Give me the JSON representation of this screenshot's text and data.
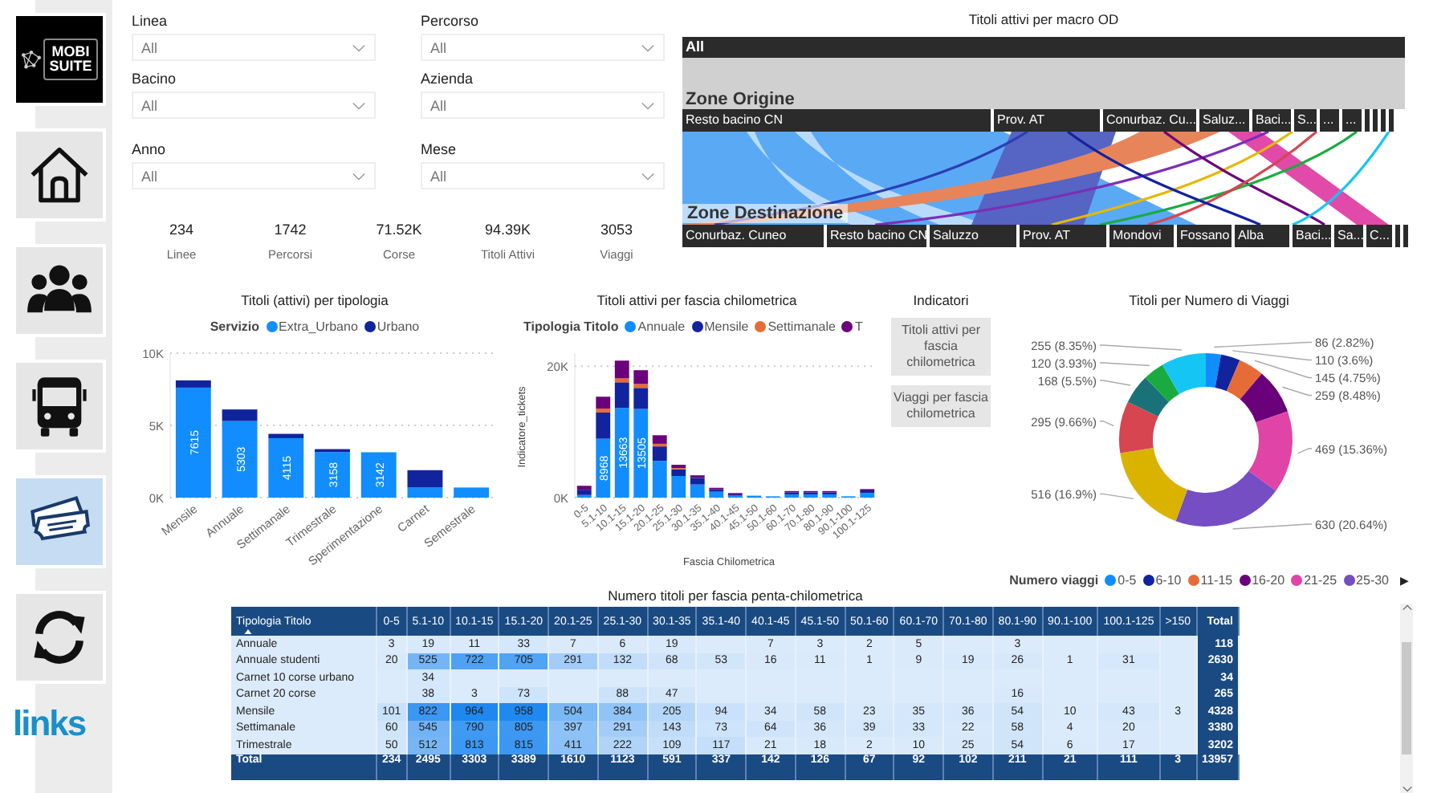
{
  "sidebar": {
    "logo_text": "MOBI SUITE",
    "nav": [
      {
        "kind": "home",
        "selected": false
      },
      {
        "kind": "people",
        "selected": false
      },
      {
        "kind": "bus",
        "selected": false
      },
      {
        "kind": "tickets",
        "selected": true
      },
      {
        "kind": "refresh",
        "selected": false
      }
    ],
    "footer_logo": "links"
  },
  "filters": [
    {
      "label": "Linea",
      "value": "All"
    },
    {
      "label": "Percorso",
      "value": "All"
    },
    {
      "label": "Bacino",
      "value": "All"
    },
    {
      "label": "Azienda",
      "value": "All"
    },
    {
      "label": "Anno",
      "value": "All"
    },
    {
      "label": "Mese",
      "value": "All"
    }
  ],
  "kpis": [
    {
      "value": "234",
      "label": "Linee"
    },
    {
      "value": "1742",
      "label": "Percorsi"
    },
    {
      "value": "71.52K",
      "label": "Corse"
    },
    {
      "value": "94.39K",
      "label": "Titoli Attivi"
    },
    {
      "value": "3053",
      "label": "Viaggi"
    }
  ],
  "od_chart": {
    "title": "Titoli attivi per macro OD",
    "root": "All",
    "origin_label": "Zone Origine",
    "destination_label": "Zone Destinazione",
    "origins": [
      "Resto bacino CN",
      "Prov. AT",
      "Conurbaz. Cu...",
      "Saluz...",
      "Baci...",
      "S...",
      "...",
      "..."
    ],
    "destinations": [
      "Conurbaz. Cuneo",
      "Resto bacino CN",
      "Saluzzo",
      "Prov. AT",
      "Mondovi",
      "Fossano",
      "Alba",
      "Baci...",
      "Sa...",
      "C..."
    ]
  },
  "type_chart": {
    "title": "Titoli (attivi) per tipologia",
    "legend_title": "Servizio",
    "chart_data": {
      "type": "bar",
      "stacked": true,
      "categories": [
        "Mensile",
        "Annuale",
        "Settimanale",
        "Trimestrale",
        "Sperimentazione",
        "Carnet",
        "Semestrale"
      ],
      "series": [
        {
          "name": "Extra_Urbano",
          "color": "#118dff",
          "values": [
            7615,
            5303,
            4115,
            3158,
            3142,
            700,
            700
          ],
          "value_labels": [
            "7615",
            "5303",
            "4115",
            "3158",
            "3142",
            null,
            null
          ]
        },
        {
          "name": "Urbano",
          "color": "#12239e",
          "values": [
            500,
            800,
            300,
            200,
            0,
            1200,
            0
          ],
          "value_labels": [
            null,
            null,
            null,
            null,
            null,
            null,
            null
          ]
        }
      ],
      "ylim": [
        0,
        10000
      ],
      "yticks": [
        {
          "value": 0,
          "label": "0K"
        },
        {
          "value": 5000,
          "label": "5K"
        },
        {
          "value": 10000,
          "label": "10K"
        }
      ]
    }
  },
  "km_chart": {
    "title": "Titoli attivi per fascia chilometrica",
    "legend_title": "Tipologia Titolo",
    "chart_data": {
      "type": "bar",
      "stacked": true,
      "xlabel": "Fascia Chilometrica",
      "ylabel": "Indicatore_tickets",
      "categories": [
        "0-5",
        "5.1-10",
        "10.1-15",
        "15.1-20",
        "20.1-25",
        "25.1-30",
        "30.1-35",
        "35.1-40",
        "40.1-45",
        "45.1-50",
        "50.1-60",
        "60.1-70",
        "70.1-80",
        "80.1-90",
        "90.1-100",
        "100.1-125"
      ],
      "series": [
        {
          "name": "Annuale",
          "color": "#118dff",
          "values": [
            400,
            8968,
            13663,
            13505,
            5600,
            3300,
            2000,
            900,
            300,
            300,
            200,
            500,
            500,
            500,
            200,
            700
          ],
          "value_labels": [
            null,
            "8968",
            "13663",
            "13505",
            null,
            null,
            null,
            null,
            null,
            null,
            null,
            null,
            null,
            null,
            null,
            null
          ]
        },
        {
          "name": "Mensile",
          "color": "#12239e",
          "values": [
            800,
            4000,
            3900,
            3200,
            2200,
            1000,
            1000,
            400,
            200,
            0,
            0,
            300,
            300,
            300,
            0,
            400
          ],
          "value_labels": [
            null,
            null,
            null,
            null,
            null,
            null,
            null,
            null,
            null,
            null,
            null,
            null,
            null,
            null,
            null,
            null
          ]
        },
        {
          "name": "Settimanale",
          "color": "#e66c37",
          "values": [
            0,
            600,
            600,
            600,
            400,
            200,
            0,
            0,
            0,
            0,
            0,
            0,
            0,
            0,
            0,
            0
          ],
          "value_labels": [
            null,
            null,
            null,
            null,
            null,
            null,
            null,
            null,
            null,
            null,
            null,
            null,
            null,
            null,
            null,
            null
          ]
        },
        {
          "name": "T",
          "color": "#6b007b",
          "values": [
            600,
            1800,
            2700,
            2100,
            1300,
            500,
            400,
            200,
            200,
            0,
            0,
            200,
            200,
            200,
            0,
            200
          ],
          "value_labels": [
            null,
            null,
            null,
            null,
            null,
            null,
            null,
            null,
            null,
            null,
            null,
            null,
            null,
            null,
            null,
            null
          ]
        }
      ],
      "ylim": [
        0,
        22000
      ],
      "yticks": [
        {
          "value": 0,
          "label": "0K"
        },
        {
          "value": 20000,
          "label": "20K"
        }
      ]
    }
  },
  "indicators": {
    "title": "Indicatori",
    "buttons": [
      "Titoli attivi per fascia chilometrica",
      "Viaggi per fascia chilometrica"
    ]
  },
  "trips_chart": {
    "title": "Titoli per Numero di Viaggi",
    "legend_title": "Numero viaggi",
    "legend_next": "▶",
    "chart_data": {
      "type": "donut",
      "categories": [
        "0-5",
        "6-10",
        "11-15",
        "16-20",
        "21-25",
        "25-30",
        null,
        null,
        null,
        null,
        null
      ],
      "series": [
        {
          "values": [
            86,
            110,
            145,
            259,
            469,
            630,
            516,
            295,
            168,
            120,
            255
          ],
          "colors": [
            "#118dff",
            "#12239e",
            "#e66c37",
            "#6b007b",
            "#e044a7",
            "#744ec2",
            "#d9b300",
            "#d64550",
            "#197278",
            "#1aab40",
            "#15c6f4"
          ],
          "value_labels": [
            "86 (2.82%)",
            "110 (3.6%)",
            "145 (4.75%)",
            "259 (8.48%)",
            "469 (15.36%)",
            "630 (20.64%)",
            "516 (16.9%)",
            "295 (9.66%)",
            "168 (5.5%)",
            "120 (3.93%)",
            "255 (8.35%)"
          ]
        }
      ]
    }
  },
  "table": {
    "title": "Numero titoli per fascia penta-chilometrica",
    "columns": [
      "Tipologia Titolo",
      "0-5",
      "5.1-10",
      "10.1-15",
      "15.1-20",
      "20.1-25",
      "25.1-30",
      "30.1-35",
      "35.1-40",
      "40.1-45",
      "45.1-50",
      "50.1-60",
      "60.1-70",
      "70.1-80",
      "80.1-90",
      "90.1-100",
      "100.1-125",
      ">150",
      "Total"
    ],
    "rows": [
      {
        "cells": [
          "Annuale",
          "3",
          "19",
          "11",
          "33",
          "7",
          "6",
          "19",
          "",
          "7",
          "3",
          "2",
          "5",
          "",
          "3",
          "",
          "",
          "",
          "118"
        ]
      },
      {
        "cells": [
          "Annuale studenti",
          "20",
          "525",
          "722",
          "705",
          "291",
          "132",
          "68",
          "53",
          "16",
          "11",
          "1",
          "9",
          "19",
          "26",
          "1",
          "31",
          "",
          "2630"
        ]
      },
      {
        "cells": [
          "Carnet 10 corse urbano",
          "",
          "34",
          "",
          "",
          "",
          "",
          "",
          "",
          "",
          "",
          "",
          "",
          "",
          "",
          "",
          "",
          "",
          "34"
        ]
      },
      {
        "cells": [
          "Carnet 20 corse",
          "",
          "38",
          "3",
          "73",
          "",
          "88",
          "47",
          "",
          "",
          "",
          "",
          "",
          "",
          "16",
          "",
          "",
          "",
          "265"
        ]
      },
      {
        "cells": [
          "Mensile",
          "101",
          "822",
          "964",
          "958",
          "504",
          "384",
          "205",
          "94",
          "34",
          "58",
          "23",
          "35",
          "36",
          "54",
          "10",
          "43",
          "3",
          "4328"
        ]
      },
      {
        "cells": [
          "Settimanale",
          "60",
          "545",
          "790",
          "805",
          "397",
          "291",
          "143",
          "73",
          "64",
          "36",
          "39",
          "33",
          "22",
          "58",
          "4",
          "20",
          "",
          "3380"
        ]
      },
      {
        "cells": [
          "Trimestrale",
          "50",
          "512",
          "813",
          "815",
          "411",
          "222",
          "109",
          "117",
          "21",
          "18",
          "2",
          "10",
          "25",
          "54",
          "6",
          "17",
          "",
          "3202"
        ]
      }
    ],
    "totals": {
      "cells": [
        "Total",
        "234",
        "2495",
        "3303",
        "3389",
        "1610",
        "1123",
        "591",
        "337",
        "142",
        "126",
        "67",
        "92",
        "102",
        "211",
        "21",
        "111",
        "3",
        "13957"
      ]
    }
  }
}
